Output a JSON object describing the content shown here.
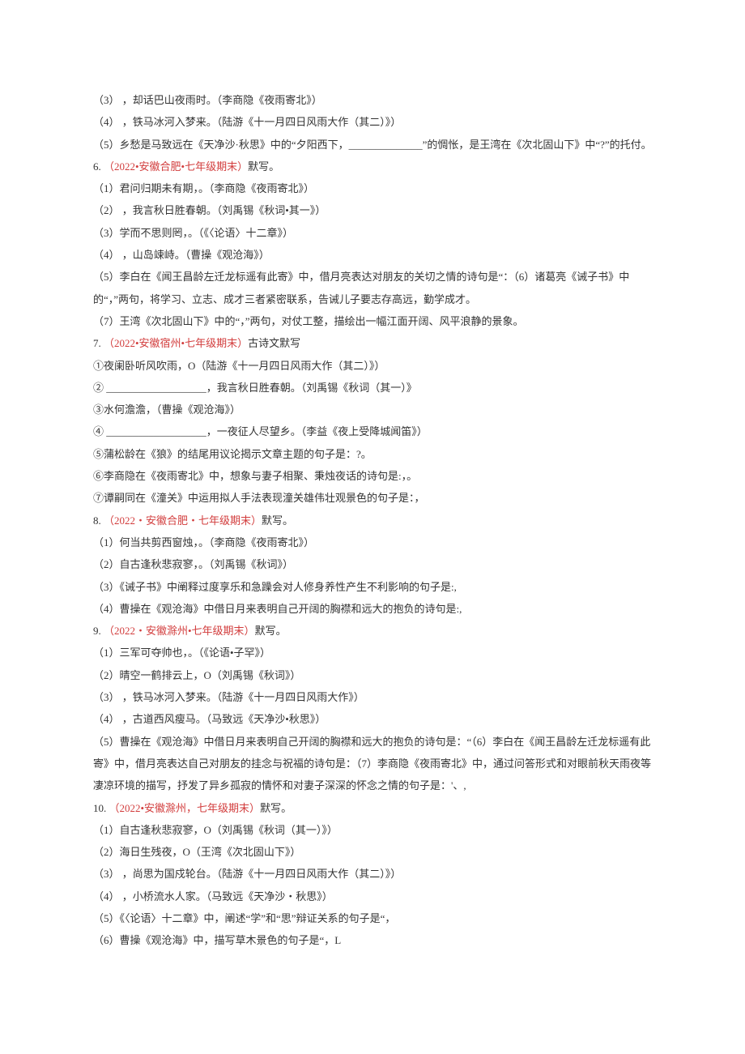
{
  "lines": [
    {
      "parts": [
        {
          "text": "（3）",
          "cls": "black"
        },
        {
          "text": "                        ，却话巴山夜雨时。（李商隐《夜雨寄北》）",
          "cls": "black"
        }
      ]
    },
    {
      "parts": [
        {
          "text": "（4）",
          "cls": "black"
        },
        {
          "text": "                        ，铁马冰河入梦来。（陆游《十一月四日风雨大作（其二）》）",
          "cls": "black"
        }
      ]
    },
    {
      "parts": [
        {
          "text": "（5）乡愁是马致远在《天净沙·秋思》中的“夕阳西下，______________”的惆怅，是王湾在《次北固山下》中“?”的托付。",
          "cls": "black"
        }
      ]
    },
    {
      "parts": [
        {
          "text": "6.  ",
          "cls": "black"
        },
        {
          "text": "（2022•安徽合肥•七年级期末）",
          "cls": "red"
        },
        {
          "text": "默写。",
          "cls": "black"
        }
      ]
    },
    {
      "parts": [
        {
          "text": "（1）君问归期未有期，。（李商隐《夜雨寄北》）",
          "cls": "black"
        }
      ]
    },
    {
      "parts": [
        {
          "text": "（2）                     ，我言秋日胜春朝。（刘禹锡《秋词•其一》）",
          "cls": "black"
        }
      ]
    },
    {
      "parts": [
        {
          "text": "（3）学而不思则罔，。（《〈论语〉十二章》）",
          "cls": "black"
        }
      ]
    },
    {
      "parts": [
        {
          "text": "（4）                        ，山岛竦峙。（曹操《观沧海》）",
          "cls": "black"
        }
      ]
    },
    {
      "parts": [
        {
          "text": "（5）李白在《闻王昌龄左迁龙标遥有此寄》中，借月亮表达对朋友的关切之情的诗句是“：（6）诸葛亮《诫子书》中的“，”两句，将学习、立志、成才三者紧密联系，告诫儿子要志存高远，勤学成才。",
          "cls": "black"
        }
      ]
    },
    {
      "parts": [
        {
          "text": "（7）王湾《次北固山下》中的“，”两句，对仗工整，描绘出一幅江面开阔、风平浪静的景象。",
          "cls": "black"
        }
      ]
    },
    {
      "parts": [
        {
          "text": "7.  ",
          "cls": "black"
        },
        {
          "text": "（2022•安徽宿州•七年级期末）",
          "cls": "red"
        },
        {
          "text": "古诗文默写",
          "cls": "black"
        }
      ]
    },
    {
      "parts": [
        {
          "text": "①夜阑卧听风吹雨，O（陆游《十一月四日风雨大作（其二）》）",
          "cls": "black"
        }
      ]
    },
    {
      "parts": [
        {
          "text": "② ___________________，我言秋日胜春朝。（刘禹锡《秋词（其一）》",
          "cls": "black"
        }
      ]
    },
    {
      "parts": [
        {
          "text": "③水何澹澹，（曹操《观沧海》）",
          "cls": "black"
        }
      ]
    },
    {
      "parts": [
        {
          "text": "④ ___________________，一夜征人尽望乡。（李益《夜上受降城闻笛》）",
          "cls": "black"
        }
      ]
    },
    {
      "parts": [
        {
          "text": "⑤蒲松龄在《狼》的结尾用议论揭示文章主题的句子是：?。",
          "cls": "black"
        }
      ]
    },
    {
      "parts": [
        {
          "text": "⑥李商隐在《夜雨寄北》中，想象与妻子相聚、秉烛夜话的诗句是:，。",
          "cls": "black"
        }
      ]
    },
    {
      "parts": [
        {
          "text": "⑦谭嗣同在《潼关》中运用拟人手法表现潼关雄伟壮观景色的句子是：，",
          "cls": "black"
        }
      ]
    },
    {
      "parts": [
        {
          "text": " ",
          "cls": "black"
        }
      ]
    },
    {
      "parts": [
        {
          "text": "8.  ",
          "cls": "black"
        },
        {
          "text": "（2022・安徽合肥・七年级期末）",
          "cls": "red"
        },
        {
          "text": "默写。",
          "cls": "black"
        }
      ]
    },
    {
      "parts": [
        {
          "text": "（1）何当共剪西窗烛，。（李商隐《夜雨寄北》）",
          "cls": "black"
        }
      ]
    },
    {
      "parts": [
        {
          "text": "（2）自古逢秋悲寂寥，。（刘禹锡《秋词》）",
          "cls": "black"
        }
      ]
    },
    {
      "parts": [
        {
          "text": "（3）《诫子书》中阐释过度享乐和急躁会对人修身养性产生不利影响的句子是:,",
          "cls": "black"
        }
      ]
    },
    {
      "parts": [
        {
          "text": "（4）曹操在《观沧海》中借日月来表明自己开阔的胸襟和远大的抱负的诗句是:,",
          "cls": "black"
        }
      ]
    },
    {
      "parts": [
        {
          "text": "9.  ",
          "cls": "black"
        },
        {
          "text": "（2022・安徽滁州•七年级期末）",
          "cls": "red"
        },
        {
          "text": "默写。",
          "cls": "black"
        }
      ]
    },
    {
      "parts": [
        {
          "text": "（1）三军可夺帅也，。（《论语•子罕》）",
          "cls": "black"
        }
      ]
    },
    {
      "parts": [
        {
          "text": "（2）晴空一鹤排云上，O（刘禹锡《秋词》）",
          "cls": "black"
        }
      ]
    },
    {
      "parts": [
        {
          "text": "（3）                        ，铁马冰河入梦来。（陆游《十一月四日风雨大作》）",
          "cls": "black"
        }
      ]
    },
    {
      "parts": [
        {
          "text": "（4）                        ，古道西风瘦马。（马致远《天净沙•秋思》）",
          "cls": "black"
        }
      ]
    },
    {
      "parts": [
        {
          "text": "（5）曹操在《观沧海》中借日月来表明自己开阔的胸襟和远大的抱负的诗句是：“（6）李白在《闻王昌龄左迁龙标遥有此寄》中，借月亮表达自己对朋友的挂念与祝福的诗句是：（7）李商隐《夜雨寄北》中，通过问答形式和对眼前秋天雨夜等凄凉环境的描写，抒发了异乡孤寂的情怀和对妻子深深的怀念之情的句子是：'、,",
          "cls": "black"
        }
      ]
    },
    {
      "parts": [
        {
          "text": "10.  ",
          "cls": "black"
        },
        {
          "text": "（2022•安徽滁州，七年级期末）",
          "cls": "red"
        },
        {
          "text": "默写。",
          "cls": "black"
        }
      ]
    },
    {
      "parts": [
        {
          "text": "（1）自古逢秋悲寂寥，O（刘禹锡《秋词（其一）》）",
          "cls": "black"
        }
      ]
    },
    {
      "parts": [
        {
          "text": "（2）海日生残夜，O（王湾《次北固山下》）",
          "cls": "black"
        }
      ]
    },
    {
      "parts": [
        {
          "text": "（3）                     ，尚思为国戍轮台。（陆游《十一月四日风雨大作（其二）》）",
          "cls": "black"
        }
      ]
    },
    {
      "parts": [
        {
          "text": "（4）                     ，小桥流水人家。（马致远《天净沙・秋思》）",
          "cls": "black"
        }
      ]
    },
    {
      "parts": [
        {
          "text": "（5）《〈论语〉十二章》中，阐述“学”和“思”辩证关系的句子是“，",
          "cls": "black"
        }
      ]
    },
    {
      "parts": [
        {
          "text": "（6）曹操《观沧海》中，描写草木景色的句子是“，L",
          "cls": "black"
        }
      ]
    }
  ]
}
